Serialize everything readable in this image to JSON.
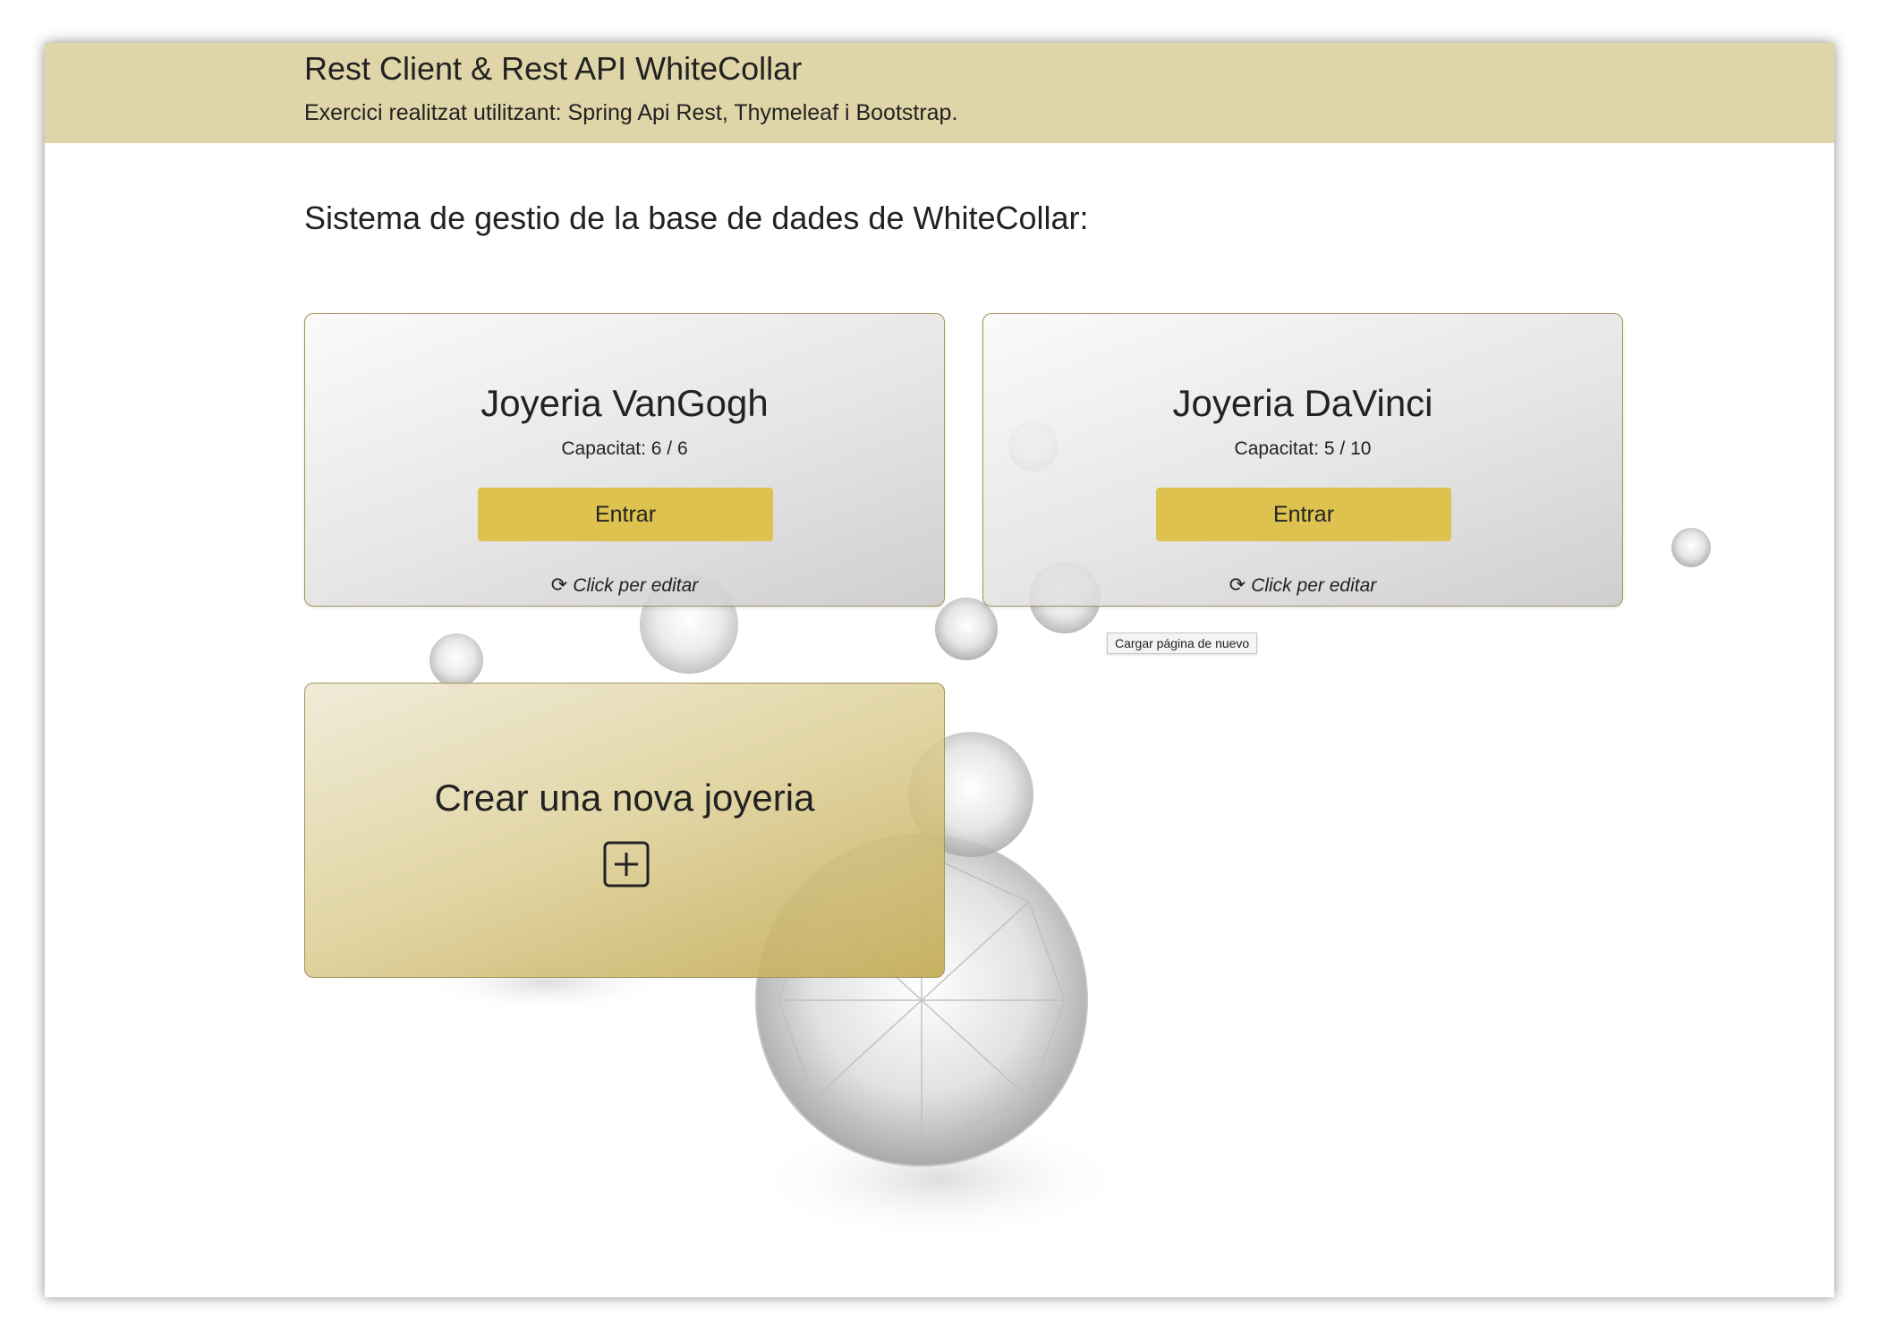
{
  "header": {
    "title": "Rest Client & Rest API WhiteCollar",
    "subtitle": "Exercici realitzat utilitzant: Spring Api Rest, Thymeleaf i Bootstrap."
  },
  "page_title": "Sistema de gestio de la base de dades de WhiteCollar:",
  "stores": [
    {
      "name": "Joyeria VanGogh",
      "capacity": "Capacitat: 6 / 6",
      "enter_label": "Entrar",
      "edit_label": "Click per editar",
      "icon": "reload-icon"
    },
    {
      "name": "Joyeria DaVinci",
      "capacity": "Capacitat: 5 / 10",
      "enter_label": "Entrar",
      "edit_label": "Click per editar",
      "icon": "reload-icon"
    }
  ],
  "tooltip": "Cargar página de nuevo",
  "create": {
    "label": "Crear una nova joyeria",
    "icon": "plus-square-icon"
  },
  "colors": {
    "header_bg": "#dfd5a8",
    "button_bg": "#dec250",
    "card_border": "#a39458"
  }
}
